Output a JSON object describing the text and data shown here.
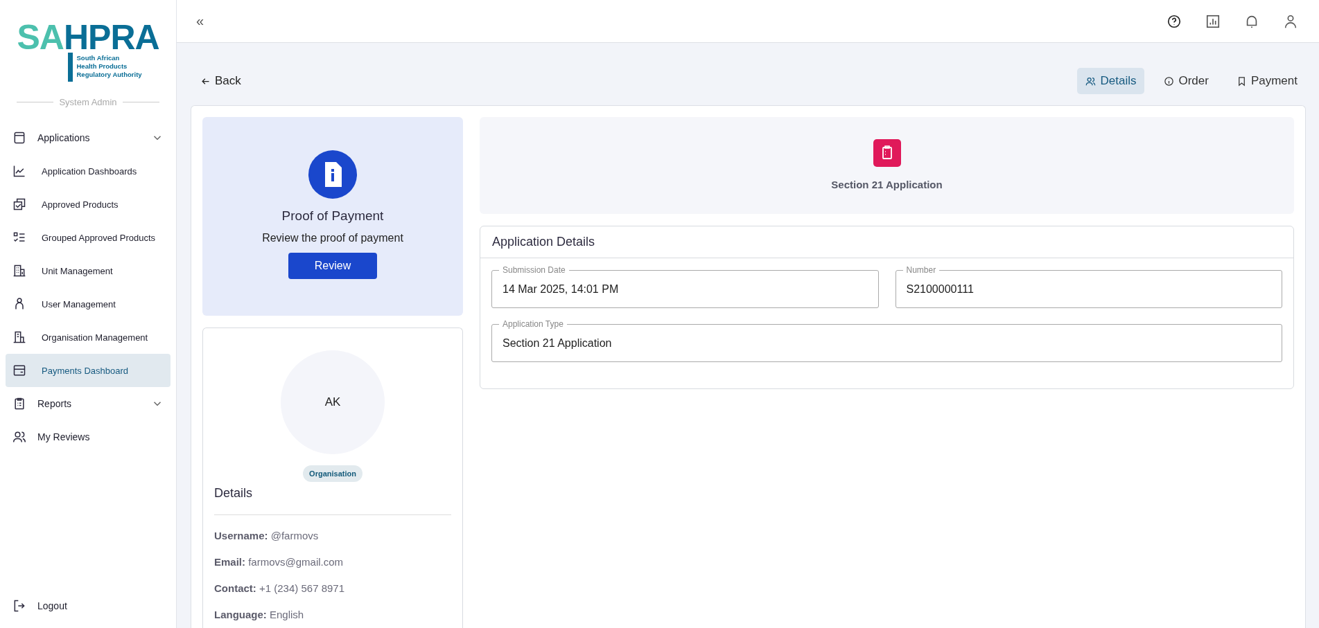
{
  "logo": {
    "letters_left": "SA",
    "letters_right": "HPRA",
    "subtitle": [
      "South African",
      "Health Products",
      "Regulatory Authority"
    ]
  },
  "sidebar": {
    "role_label": "System Admin",
    "items": [
      {
        "label": "Applications",
        "kind": "group",
        "selected": false,
        "children": [
          {
            "label": "Application Dashboards",
            "selected": false
          },
          {
            "label": "Approved Products",
            "selected": false
          },
          {
            "label": "Grouped Approved Products",
            "selected": false
          },
          {
            "label": "Unit Management",
            "selected": false
          },
          {
            "label": "User Management",
            "selected": false
          },
          {
            "label": "Organisation Management",
            "selected": false
          },
          {
            "label": "Payments Dashboard",
            "selected": true
          }
        ]
      },
      {
        "label": "Reports",
        "kind": "group",
        "selected": false
      },
      {
        "label": "My Reviews",
        "kind": "link",
        "selected": false
      }
    ],
    "logout": "Logout"
  },
  "header": {
    "collapse_glyph": "«"
  },
  "back_link": "Back",
  "tabs": [
    {
      "label": "Details",
      "selected": true
    },
    {
      "label": "Order",
      "selected": false
    },
    {
      "label": "Payment",
      "selected": false
    }
  ],
  "proof_card": {
    "title": "Proof of Payment",
    "subtitle": "Review the proof of payment",
    "button": "Review"
  },
  "profile": {
    "initials": "AK",
    "badge": "Organisation",
    "heading": "Details",
    "fields": [
      {
        "label": "Username:",
        "value": "@farmovs"
      },
      {
        "label": "Email:",
        "value": "farmovs@gmail.com"
      },
      {
        "label": "Contact:",
        "value": "+1 (234) 567 8971"
      },
      {
        "label": "Language:",
        "value": "English"
      }
    ]
  },
  "banner": {
    "title": "Section 21 Application"
  },
  "application_details": {
    "title": "Application Details",
    "fields": [
      {
        "label": "Submission Date",
        "value": "14 Mar 2025, 14:01 PM"
      },
      {
        "label": "Number",
        "value": "S2100000111"
      },
      {
        "label": "Application Type",
        "value": "Section 21 Application"
      }
    ]
  }
}
